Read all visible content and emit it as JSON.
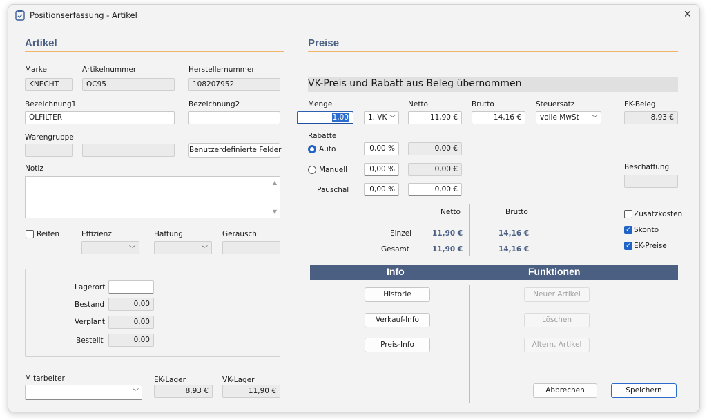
{
  "window": {
    "title": "Positionserfassung - Artikel",
    "close": "✕"
  },
  "artikel": {
    "heading": "Artikel",
    "marke_label": "Marke",
    "marke": "KNECHT",
    "artikelnummer_label": "Artikelnummer",
    "artikelnummer": "OC95",
    "herstellernummer_label": "Herstellernummer",
    "herstellernummer": "108207952",
    "bezeichnung1_label": "Bezeichnung1",
    "bezeichnung1": "ÖLFILTER",
    "bezeichnung2_label": "Bezeichnung2",
    "bezeichnung2": "",
    "warengruppe_label": "Warengruppe",
    "warengruppe": "",
    "warengruppe2": "",
    "custom_fields_button": "Benutzerdefinierte Felder",
    "notiz_label": "Notiz",
    "notiz": ""
  },
  "reifen": {
    "label": "Reifen",
    "checked": false,
    "effizienz_label": "Effizienz",
    "haftung_label": "Haftung",
    "geraeusch_label": "Geräusch"
  },
  "lager": {
    "lagerort_label": "Lagerort",
    "lagerort": "",
    "bestand_label": "Bestand",
    "bestand": "0,00",
    "verplant_label": "Verplant",
    "verplant": "0,00",
    "bestellt_label": "Bestellt",
    "bestellt": "0,00"
  },
  "bottom": {
    "mitarbeiter_label": "Mitarbeiter",
    "mitarbeiter": "",
    "ek_lager_label": "EK-Lager",
    "ek_lager": "8,93 €",
    "vk_lager_label": "VK-Lager",
    "vk_lager": "11,90 €"
  },
  "preise": {
    "heading": "Preise",
    "banner": "VK-Preis und Rabatt aus Beleg übernommen",
    "menge_label": "Menge",
    "menge": "1,00",
    "vk_select": "1. VK",
    "netto_label": "Netto",
    "netto": "11,90 €",
    "brutto_label": "Brutto",
    "brutto": "14,16 €",
    "steuersatz_label": "Steuersatz",
    "steuersatz": "volle MwSt",
    "ek_beleg_label": "EK-Beleg",
    "ek_beleg": "8,93 €",
    "rabatte_label": "Rabatte",
    "auto_label": "Auto",
    "auto_pct": "0,00 %",
    "auto_val": "0,00 €",
    "manuell_label": "Manuell",
    "manuell_pct": "0,00 %",
    "manuell_val": "0,00 €",
    "pauschal_label": "Pauschal",
    "pauschal_pct": "0,00 %",
    "pauschal_val": "0,00 €",
    "beschaffung_label": "Beschaffung",
    "beschaffung": "",
    "sum_netto_label": "Netto",
    "sum_brutto_label": "Brutto",
    "einzel_label": "Einzel",
    "einzel_netto": "11,90 €",
    "einzel_brutto": "14,16 €",
    "gesamt_label": "Gesamt",
    "gesamt_netto": "11,90 €",
    "gesamt_brutto": "14,16 €",
    "zusatzkosten_label": "Zusatzkosten",
    "zusatzkosten": false,
    "skonto_label": "Skonto",
    "skonto": true,
    "ek_preise_label": "EK-Preise",
    "ek_preise": true
  },
  "info": {
    "heading": "Info",
    "historie": "Historie",
    "verkauf_info": "Verkauf-Info",
    "preis_info": "Preis-Info"
  },
  "funktionen": {
    "heading": "Funktionen",
    "neuer_artikel": "Neuer Artikel",
    "loeschen": "Löschen",
    "altern_artikel": "Altern. Artikel"
  },
  "actions": {
    "abbrechen": "Abbrechen",
    "speichern": "Speichern"
  },
  "colors": {
    "accent": "#4a5f82",
    "rule": "#f0b46a",
    "checkbox": "#1f63c6"
  },
  "icons": {
    "app": "clipboard-icon",
    "close": "close-icon",
    "dropdown": "chevron-down-icon",
    "scroll_up": "scroll-up-icon",
    "scroll_down": "scroll-down-icon"
  }
}
